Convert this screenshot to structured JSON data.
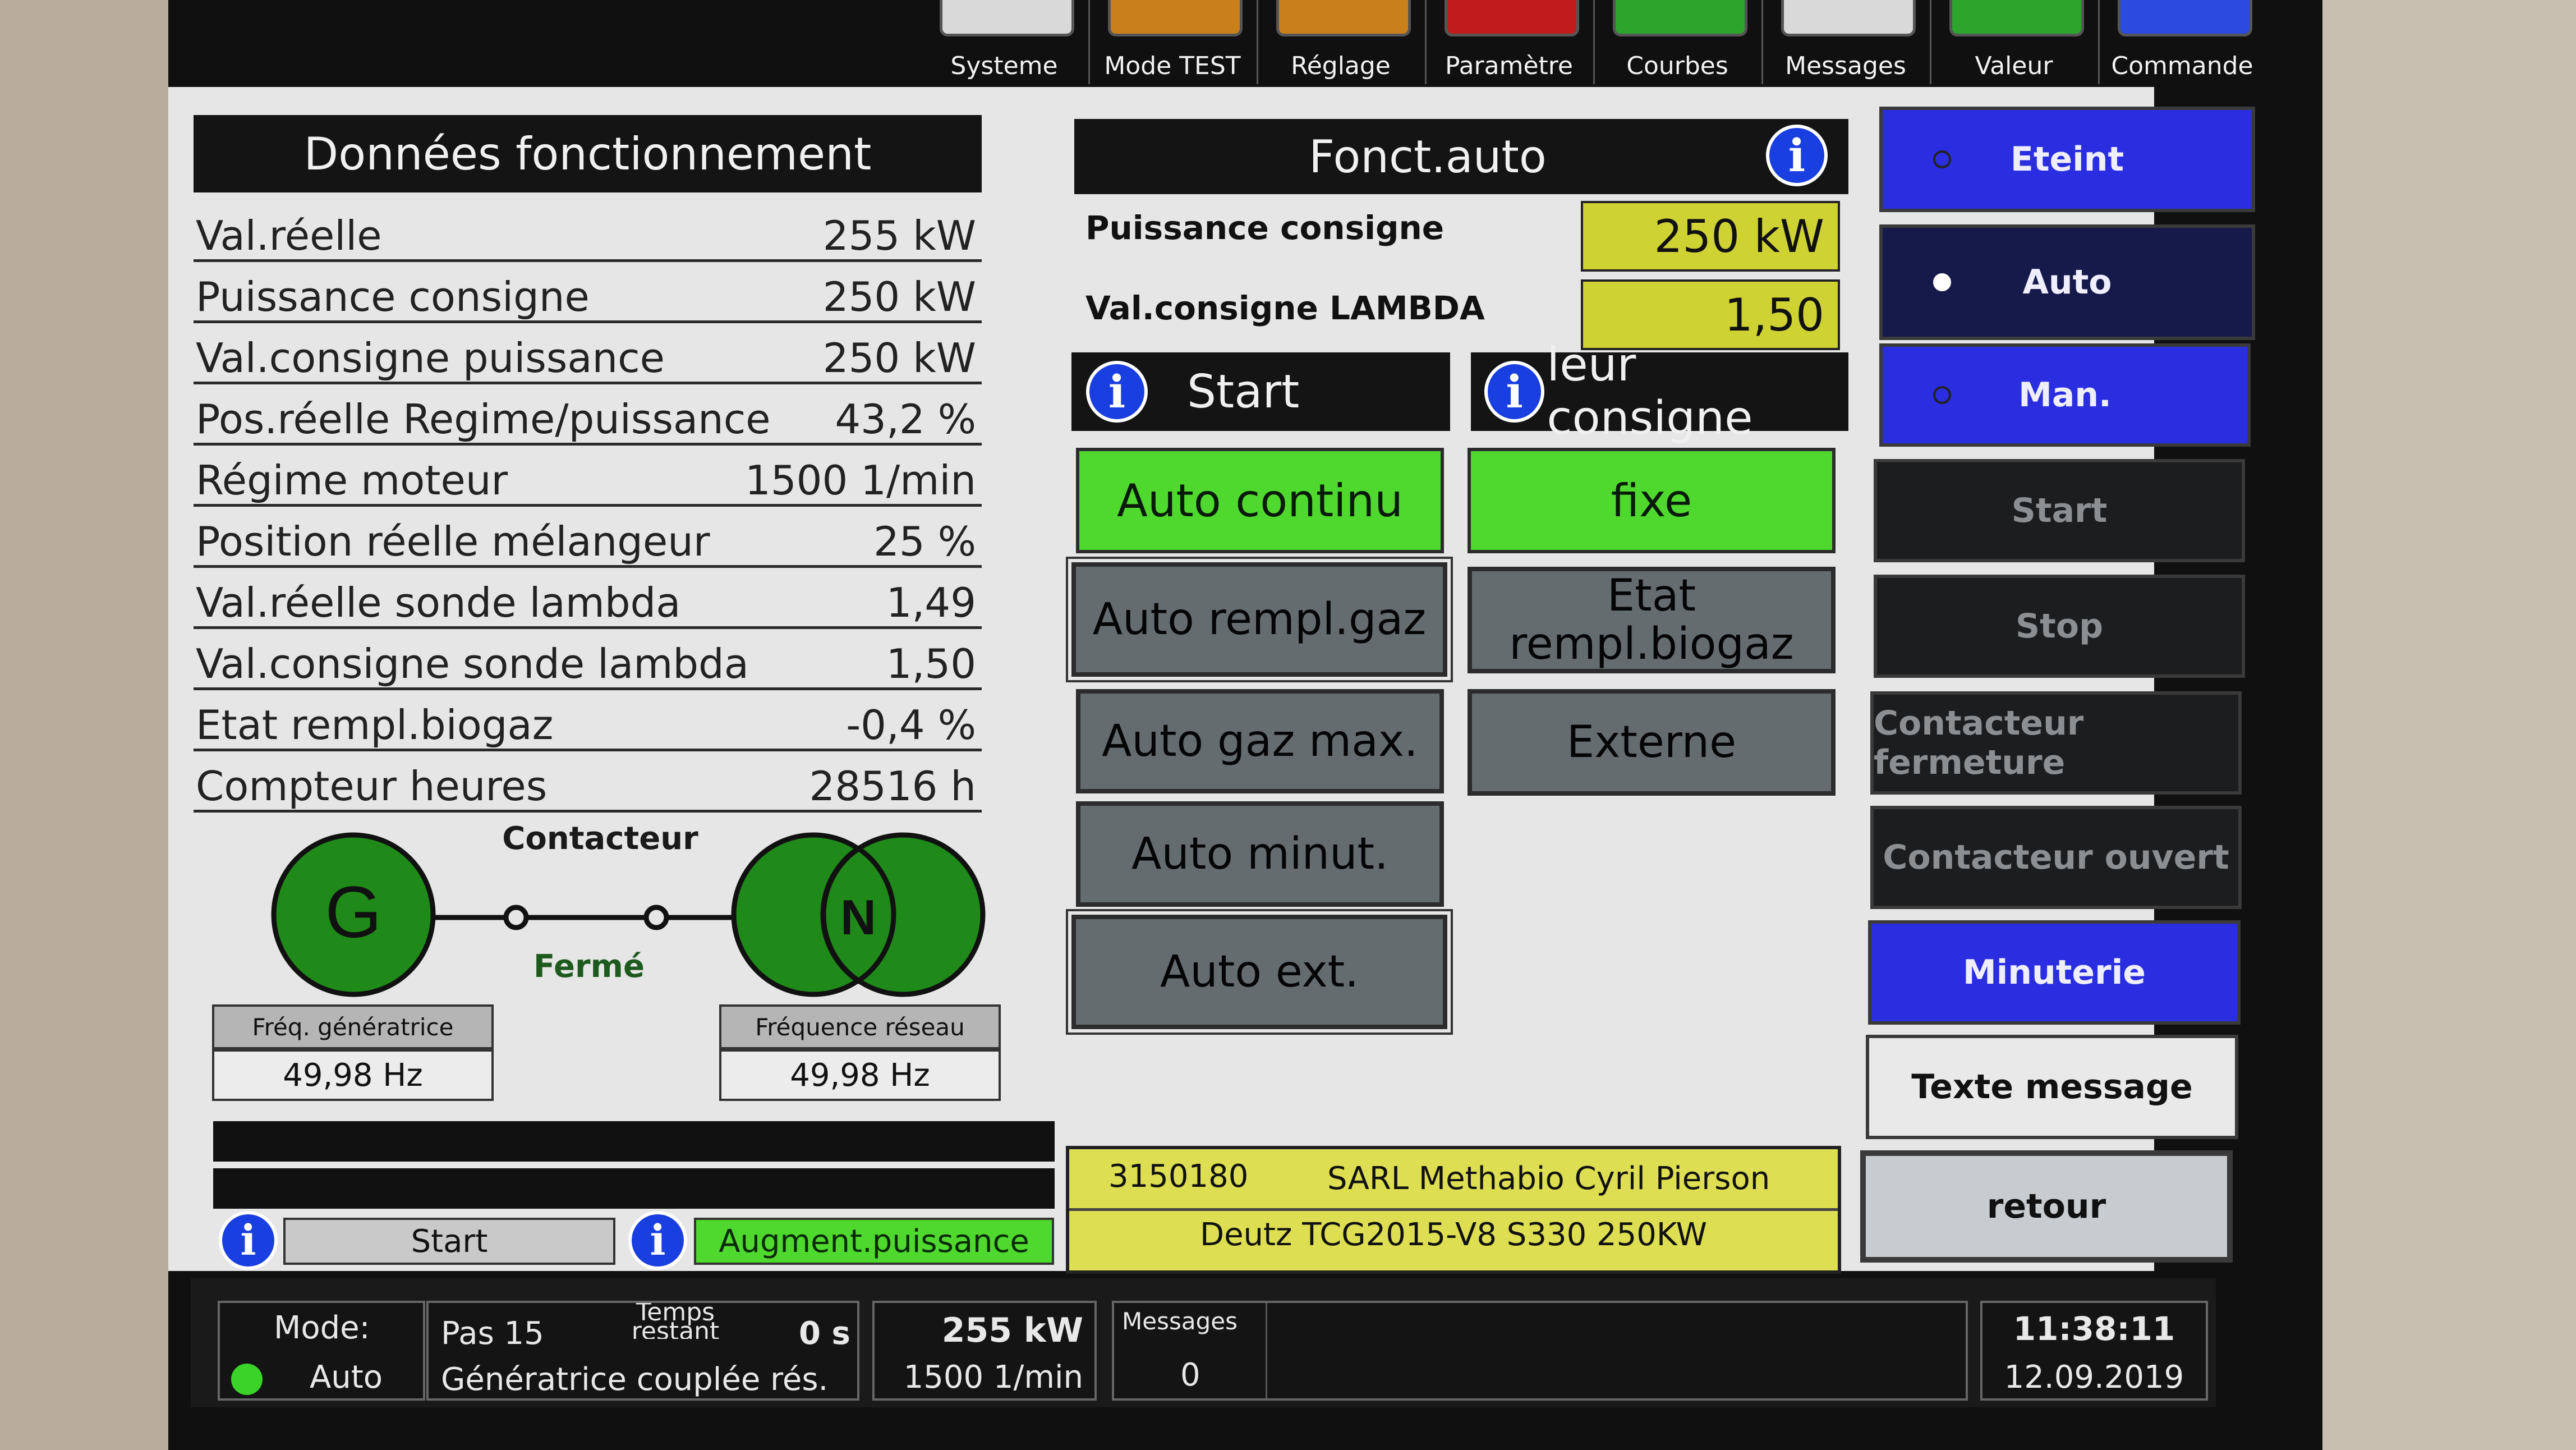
{
  "menu": [
    "Systeme",
    "Mode TEST",
    "Réglage",
    "Paramètre",
    "Courbes",
    "Messages",
    "Valeur",
    "Commande"
  ],
  "menu_colors": [
    "#d9d9d9",
    "#c9801a",
    "#c9801a",
    "#c01c1c",
    "#2da52d",
    "#d9d9d9",
    "#2da52d",
    "#2a4ae0"
  ],
  "left": {
    "title": "Données fonctionnement",
    "rows": [
      {
        "label": "Val.réelle",
        "value": "255 kW"
      },
      {
        "label": "Puissance consigne",
        "value": "250 kW"
      },
      {
        "label": "Val.consigne puissance",
        "value": "250 kW"
      },
      {
        "label": "Pos.réelle Regime/puissance",
        "value": "43,2 %"
      },
      {
        "label": "Régime moteur",
        "value": "1500 1/min"
      },
      {
        "label": "Position réelle mélangeur",
        "value": "25 %"
      },
      {
        "label": "Val.réelle sonde lambda",
        "value": "1,49"
      },
      {
        "label": "Val.consigne sonde lambda",
        "value": "1,50"
      },
      {
        "label": "Etat rempl.biogaz",
        "value": "-0,4 %"
      },
      {
        "label": "Compteur heures",
        "value": "28516 h"
      }
    ],
    "diagram": {
      "contactor_label": "Contacteur",
      "gen_symbol": "G",
      "net_symbol": "N",
      "state": "Fermé",
      "gen_freq_label": "Fréq. génératrice",
      "gen_freq_value": "49,98 Hz",
      "net_freq_label": "Fréquence réseau",
      "net_freq_value": "49,98 Hz"
    },
    "status_start": "Start",
    "status_augment": "Augment.puissance"
  },
  "center": {
    "title": "Fonct.auto",
    "info": "i",
    "power_label": "Puissance consigne",
    "power_value": "250 kW",
    "lambda_label": "Val.consigne LAMBDA",
    "lambda_value": "1,50",
    "start_label": "Start",
    "valeur_label": "leur consigne",
    "buttons_left": [
      "Auto continu",
      "Auto rempl.gaz",
      "Auto gaz max.",
      "Auto minut.",
      "Auto ext."
    ],
    "buttons_right": [
      "fixe",
      "Etat rempl.biogaz",
      "Externe"
    ],
    "plate_id": "3150180",
    "plate_owner": "SARL Methabio Cyril Pierson",
    "plate_engine": "Deutz TCG2015-V8 S330 250KW"
  },
  "right": [
    {
      "label": "Eteint",
      "style": "blue"
    },
    {
      "label": "Auto",
      "style": "navy"
    },
    {
      "label": "Man.",
      "style": "blue"
    },
    {
      "label": "Start",
      "style": "dark"
    },
    {
      "label": "Stop",
      "style": "dark"
    },
    {
      "label": "Contacteur fermeture",
      "style": "dark"
    },
    {
      "label": "Contacteur ouvert",
      "style": "dark"
    },
    {
      "label": "Minuterie",
      "style": "blue"
    },
    {
      "label": "Texte message",
      "style": "light"
    },
    {
      "label": "retour",
      "style": "retour"
    }
  ],
  "statusbar": {
    "mode_label": "Mode:",
    "mode_value": "Auto",
    "step": "Pas 15",
    "time_label": "Temps restant",
    "time_value": "0 s",
    "state_text": "Génératrice couplée rés.",
    "power": "255 kW",
    "speed": "1500 1/min",
    "messages_label": "Messages",
    "messages_value": "0",
    "time": "11:38:11",
    "date": "12.09.2019"
  }
}
